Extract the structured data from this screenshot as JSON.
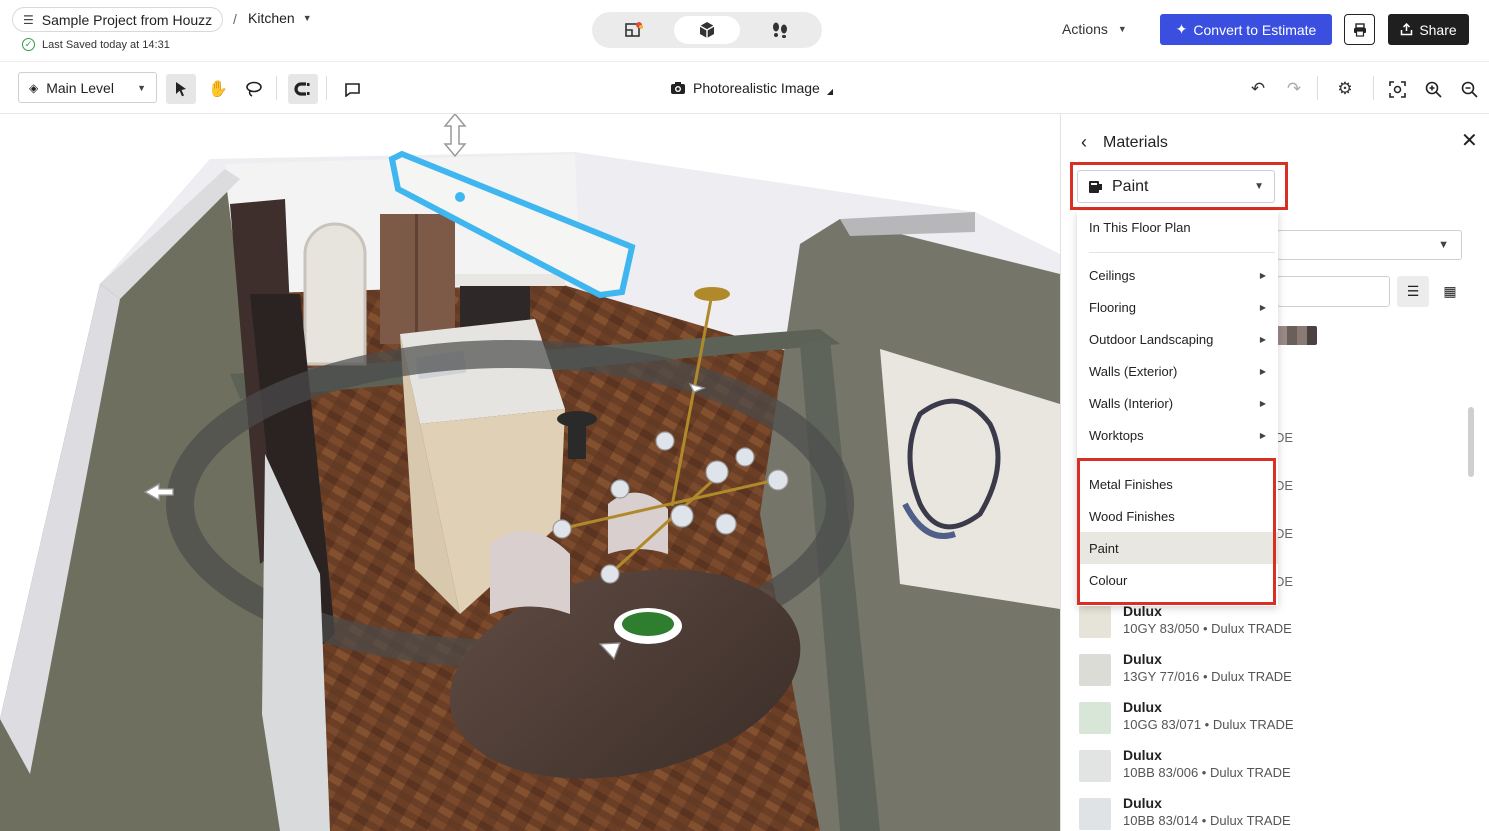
{
  "header": {
    "project_name": "Sample Project from Houzz",
    "breadcrumb_separator": "/",
    "room_name": "Kitchen",
    "saved_status": "Last Saved today at 14:31",
    "actions_label": "Actions",
    "convert_label": "Convert to Estimate",
    "share_label": "Share"
  },
  "toolbar": {
    "level_label": "Main Level",
    "photo_label": "Photorealistic Image"
  },
  "panel": {
    "title": "Materials",
    "category_selected": "Paint",
    "dropdown": {
      "top_item": "In This Floor Plan",
      "groups": [
        "Ceilings",
        "Flooring",
        "Outdoor Landscaping",
        "Walls (Exterior)",
        "Walls (Interior)",
        "Worktops"
      ],
      "types": [
        "Metal Finishes",
        "Wood Finishes",
        "Paint",
        "Colour"
      ],
      "selected_type": "Paint"
    },
    "trade_fragment": "DE",
    "materials": [
      {
        "brand": "Dulux",
        "code": "10GY 83/050 • Dulux TRADE",
        "color": "#e6e4d8"
      },
      {
        "brand": "Dulux",
        "code": "13GY 77/016 • Dulux TRADE",
        "color": "#dcdcd6"
      },
      {
        "brand": "Dulux",
        "code": "10GG 83/071 • Dulux TRADE",
        "color": "#d7e6d6"
      },
      {
        "brand": "Dulux",
        "code": "10BB 83/006 • Dulux TRADE",
        "color": "#e2e4e4"
      },
      {
        "brand": "Dulux",
        "code": "10BB 83/014 • Dulux TRADE",
        "color": "#e0e3e5"
      }
    ]
  },
  "colors": {
    "accent_blue": "#3a4ee0",
    "highlight_red": "#d93025",
    "selection_cyan": "#3fb6ef",
    "wall_olive": "#6f6f5f"
  }
}
